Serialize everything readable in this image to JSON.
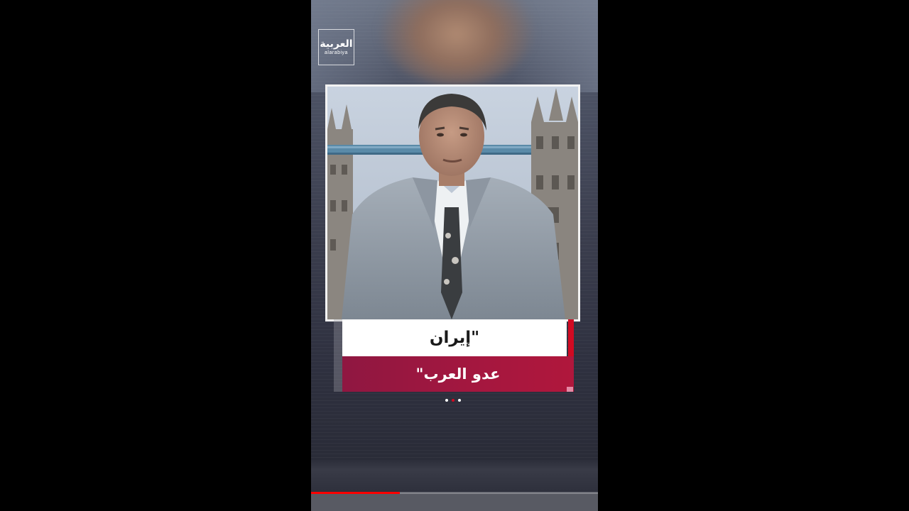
{
  "logo": {
    "arabic": "العربية",
    "latin": "alarabiya"
  },
  "caption": {
    "line1": "\"إيران",
    "line2": "عدو العرب\""
  },
  "pager": {
    "count": 3,
    "active_index": 1,
    "active_color": "#d10a22",
    "inactive_color": "#ffffff"
  },
  "playback": {
    "progress_fraction": 0.31,
    "progress_color": "#ff0000"
  },
  "colors": {
    "caption_red": "#a5173f",
    "accent_red": "#d10a22"
  }
}
